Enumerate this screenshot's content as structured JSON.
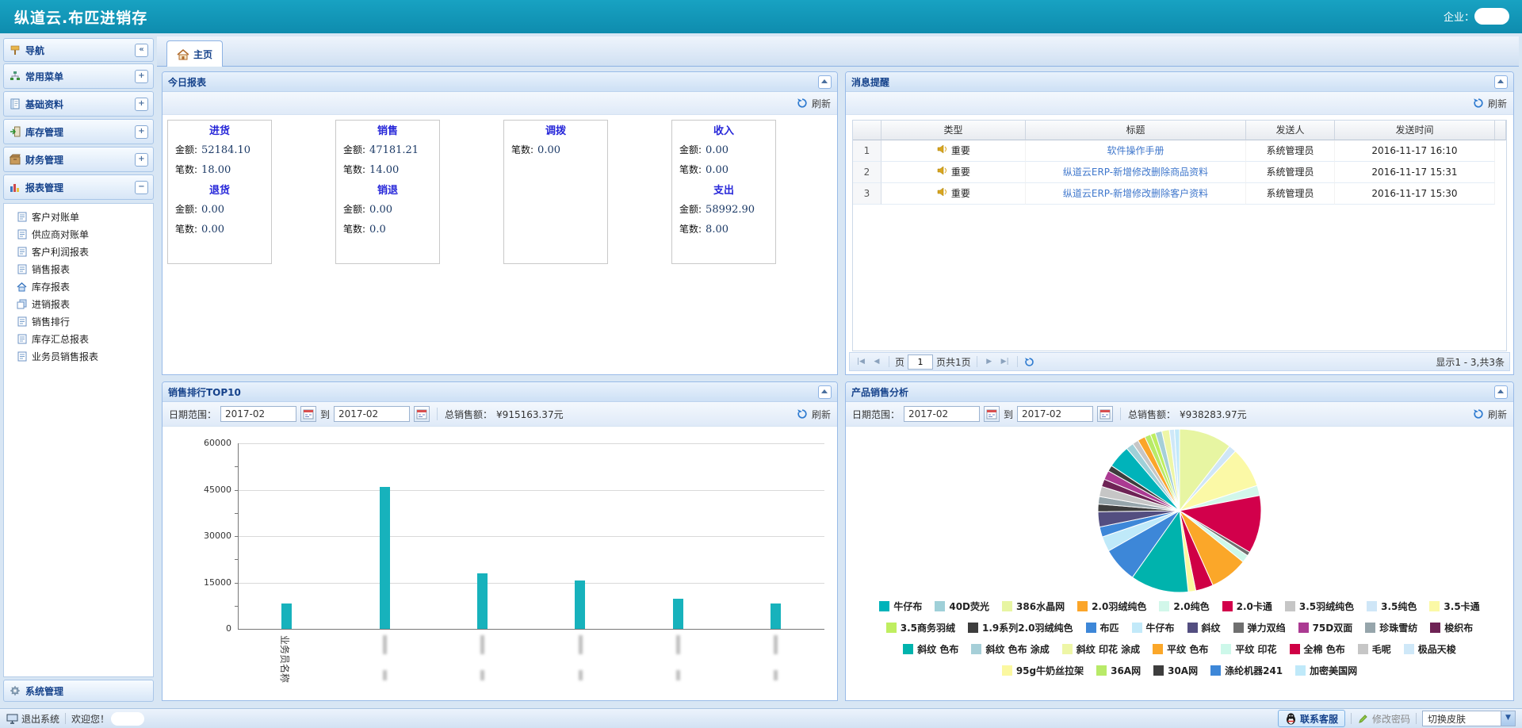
{
  "app": {
    "title": "纵道云.布匹进销存",
    "enterprise_label": "企业：",
    "tab_home": "主页",
    "logout": "退出系统",
    "welcome": "欢迎您！",
    "contact_support": "联系客服",
    "change_password": "修改密码",
    "switch_skin": "切换皮肤"
  },
  "colors": {
    "topbar": "#1194b6",
    "panel_border": "#99bbe8",
    "header_text": "#15428b",
    "bar_color": "#17b2bc",
    "link": "#3f77cc",
    "card_title_blue": "#2626d9"
  },
  "icons": {
    "home-icon": "house",
    "signpost-icon": "navigation signpost",
    "refresh-icon": "blue circular arrows",
    "calendar-icon": "date picker grid",
    "speaker-icon": "gold announcement horn",
    "qq-icon": "QQ penguin",
    "monitor-icon": "computer monitor",
    "pencil-icon": "green pencil",
    "collapse-icon": "chevron-up button",
    "sidebar-collapse-icon": "double chevron left"
  },
  "sidebar": {
    "nav_title": "导航",
    "sections": [
      {
        "label": "常用菜单",
        "icon": "org",
        "expand": "+"
      },
      {
        "label": "基础资料",
        "icon": "book",
        "expand": "+"
      },
      {
        "label": "库存管理",
        "icon": "door",
        "expand": "+"
      },
      {
        "label": "财务管理",
        "icon": "box",
        "expand": "+"
      },
      {
        "label": "报表管理",
        "icon": "chart",
        "expand": "−"
      }
    ],
    "report_items": [
      {
        "label": "客户对账单",
        "icon": "doc"
      },
      {
        "label": "供应商对账单",
        "icon": "doc"
      },
      {
        "label": "客户利润报表",
        "icon": "doc"
      },
      {
        "label": "销售报表",
        "icon": "doc"
      },
      {
        "label": "库存报表",
        "icon": "home"
      },
      {
        "label": "进销报表",
        "icon": "copy"
      },
      {
        "label": "销售排行",
        "icon": "doc"
      },
      {
        "label": "库存汇总报表",
        "icon": "doc"
      },
      {
        "label": "业务员销售报表",
        "icon": "doc"
      }
    ],
    "bottom_section": "系统管理"
  },
  "panels": {
    "today": {
      "title": "今日报表",
      "refresh": "刷新",
      "cards": [
        {
          "groups": [
            {
              "title": "进货",
              "metrics": [
                {
                  "label": "金额:",
                  "value": "52184.10"
                },
                {
                  "label": "笔数:",
                  "value": "18.00"
                }
              ]
            },
            {
              "title": "退货",
              "metrics": [
                {
                  "label": "金额:",
                  "value": "0.00"
                },
                {
                  "label": "笔数:",
                  "value": "0.00"
                }
              ]
            }
          ]
        },
        {
          "groups": [
            {
              "title": "销售",
              "metrics": [
                {
                  "label": "金额:",
                  "value": "47181.21"
                },
                {
                  "label": "笔数:",
                  "value": "14.00"
                }
              ]
            },
            {
              "title": "销退",
              "metrics": [
                {
                  "label": "金额:",
                  "value": "0.00"
                },
                {
                  "label": "笔数:",
                  "value": "0.0"
                }
              ]
            }
          ]
        },
        {
          "groups": [
            {
              "title": "调拨",
              "metrics": [
                {
                  "label": "笔数:",
                  "value": "0.00"
                }
              ]
            }
          ]
        },
        {
          "groups": [
            {
              "title": "收入",
              "metrics": [
                {
                  "label": "金额:",
                  "value": "0.00"
                },
                {
                  "label": "笔数:",
                  "value": "0.00"
                }
              ]
            },
            {
              "title": "支出",
              "metrics": [
                {
                  "label": "金额:",
                  "value": "58992.90"
                },
                {
                  "label": "笔数:",
                  "value": "8.00"
                }
              ]
            }
          ]
        }
      ]
    },
    "messages": {
      "title": "消息提醒",
      "refresh": "刷新",
      "columns": [
        "类型",
        "标题",
        "发送人",
        "发送时间"
      ],
      "type_value": "重要",
      "rows": [
        {
          "num": "1",
          "type": "重要",
          "title": "软件操作手册",
          "sender": "系统管理员",
          "time": "2016-11-17 16:10"
        },
        {
          "num": "2",
          "type": "重要",
          "title": "纵道云ERP-新增修改删除商品资料",
          "sender": "系统管理员",
          "time": "2016-11-17 15:31"
        },
        {
          "num": "3",
          "type": "重要",
          "title": "纵道云ERP-新增修改删除客户资料",
          "sender": "系统管理员",
          "time": "2016-11-17 15:30"
        }
      ],
      "pager": {
        "page_label": "页",
        "page_value": "1",
        "pages_suffix": "页共1页",
        "summary": "显示1 - 3,共3条"
      }
    },
    "rank": {
      "title": "销售排行TOP10",
      "date_label": "日期范围：",
      "from": "2017-02",
      "to_word": "到",
      "to": "2017-02",
      "total_label": "总销售额：",
      "total": "¥915163.37元",
      "refresh": "刷新"
    },
    "product": {
      "title": "产品销售分析",
      "date_label": "日期范围：",
      "from": "2017-02",
      "to_word": "到",
      "to": "2017-02",
      "total_label": "总销售额：",
      "total": "¥938283.97元",
      "refresh": "刷新"
    }
  },
  "chart_data": [
    {
      "type": "bar",
      "title": "销售排行TOP10",
      "xlabel": "业务员名称",
      "categories": [
        "业务员名称",
        "",
        "",
        "",
        "",
        ""
      ],
      "categories_note": "salesperson name labels 2-6 are illegible (blurred) in the screenshot",
      "values": [
        8200,
        45800,
        17900,
        15600,
        9700,
        8300
      ],
      "ylim": [
        0,
        60000
      ],
      "yticks": [
        0,
        15000,
        30000,
        45000,
        60000
      ],
      "bar_color": "#17b2bc",
      "grid": true,
      "legend_position": "none"
    },
    {
      "type": "pie",
      "title": "产品销售分析",
      "legend_position": "bottom",
      "legend": [
        {
          "label": "牛仔布",
          "color": "#00b3ba",
          "row": 1
        },
        {
          "label": "40D荧光",
          "color": "#9fd0d8",
          "row": 1
        },
        {
          "label": "386水晶网",
          "color": "#e7f5a2",
          "row": 1
        },
        {
          "label": "2.0羽绒纯色",
          "color": "#fba529",
          "row": 1
        },
        {
          "label": "2.0纯色",
          "color": "#d2f7ea",
          "row": 1
        },
        {
          "label": "2.0卡通",
          "color": "#d2004b",
          "row": 1
        },
        {
          "label": "3.5羽绒纯色",
          "color": "#c6c6c6",
          "row": 1
        },
        {
          "label": "3.5纯色",
          "color": "#cfe6f7",
          "row": 1
        },
        {
          "label": "3.5卡通",
          "color": "#fbf9a6",
          "row": 1
        },
        {
          "label": "3.5商务羽绒",
          "color": "#bfee60",
          "row": 2
        },
        {
          "label": "1.9系列2.0羽绒纯色",
          "color": "#3d3d3d",
          "row": 2
        },
        {
          "label": "布匹",
          "color": "#3d87d8",
          "row": 2
        },
        {
          "label": "牛仔布",
          "color": "#c2e9f9",
          "row": 2
        },
        {
          "label": "斜纹",
          "color": "#534e80",
          "row": 2
        },
        {
          "label": "弹力双绉",
          "color": "#6f6f6f",
          "row": 2
        },
        {
          "label": "75D双面",
          "color": "#ab3a92",
          "row": 2
        },
        {
          "label": "珍珠雪纺",
          "color": "#96a5ab",
          "row": 2
        },
        {
          "label": "梭织布",
          "color": "#6e2355",
          "row": 2
        },
        {
          "label": "斜纹 色布",
          "color": "#00b3ad",
          "row": 3
        },
        {
          "label": "斜纹 色布 涂成",
          "color": "#a6cfd8",
          "row": 3
        },
        {
          "label": "斜纹 印花 涂成",
          "color": "#eef6a6",
          "row": 3
        },
        {
          "label": "平纹 色布",
          "color": "#fba729",
          "row": 3
        },
        {
          "label": "平纹 印花",
          "color": "#cdf8ea",
          "row": 3
        },
        {
          "label": "全棉 色布",
          "color": "#cf0045",
          "row": 3
        },
        {
          "label": "毛呢",
          "color": "#c6c6c6",
          "row": 3
        },
        {
          "label": "极品天梭",
          "color": "#cfe8f8",
          "row": 3
        },
        {
          "label": "95g牛奶丝拉架",
          "color": "#fbf8a0",
          "row": 4
        },
        {
          "label": "36A网",
          "color": "#b8ea68",
          "row": 4
        },
        {
          "label": "30A网",
          "color": "#3d3d3d",
          "row": 4
        },
        {
          "label": "涤纶机器241",
          "color": "#3d87d8",
          "row": 4
        },
        {
          "label": "加密美国网",
          "color": "#bfe9f9",
          "row": 4
        }
      ],
      "slices": [
        {
          "label": "386水晶网",
          "color": "#e7f5a2",
          "pct": 10.5
        },
        {
          "label": "3.5纯色",
          "color": "#cfe6f7",
          "pct": 1.5
        },
        {
          "label": "3.5卡通",
          "color": "#fbf9a6",
          "pct": 8
        },
        {
          "label": "2.0纯色",
          "color": "#d2f7ea",
          "pct": 2
        },
        {
          "label": "2.0卡通",
          "color": "#d2004b",
          "pct": 11.5
        },
        {
          "label": "弹力双绉",
          "color": "#6f6f6f",
          "pct": 0.8
        },
        {
          "label": "平纹 印花",
          "color": "#cdf8ea",
          "pct": 1.5
        },
        {
          "label": "平纹 色布",
          "color": "#fba729",
          "pct": 7.5
        },
        {
          "label": "全棉 色布",
          "color": "#cf0045",
          "pct": 3.5
        },
        {
          "label": "95g牛奶丝拉架",
          "color": "#fbf8a0",
          "pct": 1.5
        },
        {
          "label": "斜纹 色布",
          "color": "#00b3ad",
          "pct": 11.5
        },
        {
          "label": "布匹",
          "color": "#3d87d8",
          "pct": 7
        },
        {
          "label": "加密美国网",
          "color": "#bfe9f9",
          "pct": 3
        },
        {
          "label": "涤纶机器241",
          "color": "#3d87d8",
          "pct": 2
        },
        {
          "label": "斜纹",
          "color": "#534e80",
          "pct": 3
        },
        {
          "label": "30A网",
          "color": "#3d3d3d",
          "pct": 1.5
        },
        {
          "label": "珍珠雪纺",
          "color": "#96a5ab",
          "pct": 1.5
        },
        {
          "label": "毛呢",
          "color": "#c6c6c6",
          "pct": 2
        },
        {
          "label": "梭织布",
          "color": "#6e2355",
          "pct": 1.5
        },
        {
          "label": "75D双面",
          "color": "#ab3a92",
          "pct": 1.8
        },
        {
          "label": "1.9系列2.0羽绒纯色",
          "color": "#3d3d3d",
          "pct": 1.2
        },
        {
          "label": "牛仔布",
          "color": "#00b3ba",
          "pct": 4.5
        },
        {
          "label": "40D荧光",
          "color": "#9fd0d8",
          "pct": 1.5
        },
        {
          "label": "3.5羽绒纯色",
          "color": "#c6c6c6",
          "pct": 1.2
        },
        {
          "label": "2.0羽绒纯色",
          "color": "#fba529",
          "pct": 1.5
        },
        {
          "label": "36A网",
          "color": "#b8ea68",
          "pct": 1.2
        },
        {
          "label": "3.5商务羽绒",
          "color": "#bfee60",
          "pct": 1.0
        },
        {
          "label": "斜纹 色布 涂成",
          "color": "#a6cfd8",
          "pct": 1.3
        },
        {
          "label": "斜纹 印花 涂成",
          "color": "#eef6a6",
          "pct": 1.5
        },
        {
          "label": "极品天梭",
          "color": "#cfe8f8",
          "pct": 1.0
        },
        {
          "label": "牛仔布",
          "color": "#c2e9f9",
          "pct": 1.0
        }
      ]
    }
  ]
}
